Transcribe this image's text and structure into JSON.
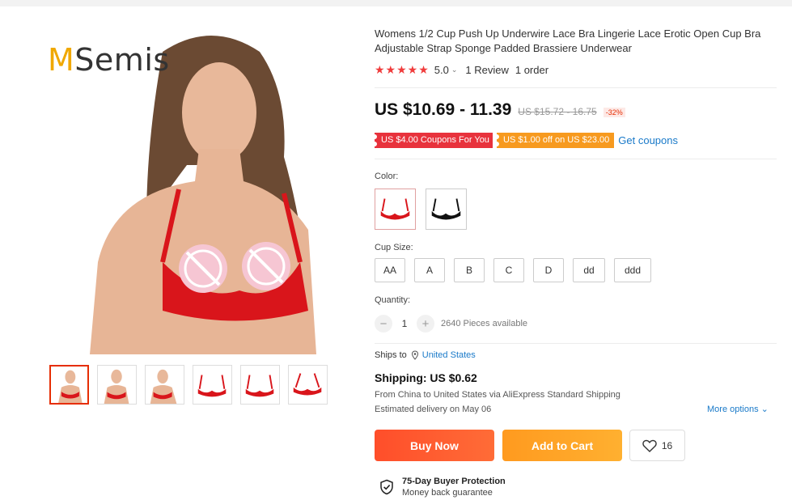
{
  "brand": {
    "initial": "M",
    "rest": "Semis"
  },
  "product": {
    "title": "Womens 1/2 Cup Push Up Underwire Lace Bra Lingerie Lace Erotic Open Cup Bra Adjustable Strap Sponge Padded Brassiere Underwear",
    "stars": "★★★★★",
    "rating": "5.0",
    "rating_chevron": "⌄",
    "reviews": "1 Review",
    "orders": "1 order"
  },
  "price": {
    "current": "US $10.69 - 11.39",
    "original": "US $15.72 - 16.75",
    "discount": "-32%"
  },
  "coupons": {
    "coupon1": "US $4.00 Coupons For You",
    "coupon2": "US $1.00 off on US $23.00",
    "get_coupons": "Get coupons"
  },
  "color": {
    "label": "Color:",
    "options": [
      "red",
      "black"
    ]
  },
  "cup_size": {
    "label": "Cup Size:",
    "options": [
      "AA",
      "A",
      "B",
      "C",
      "D",
      "dd",
      "ddd"
    ]
  },
  "quantity": {
    "label": "Quantity:",
    "minus": "−",
    "value": "1",
    "plus": "+",
    "available": "2640 Pieces available"
  },
  "shipping": {
    "ships_to_label": "Ships to",
    "country": "United States",
    "title": "Shipping: US $0.62",
    "from": "From China to United States via AliExpress Standard Shipping",
    "estimate": "Estimated delivery on May 06",
    "more_options": "More options ⌄"
  },
  "actions": {
    "buy_now": "Buy Now",
    "add_to_cart": "Add to Cart",
    "wishlist_count": "16"
  },
  "protection": {
    "title": "75-Day Buyer Protection",
    "subtitle": "Money back guarantee"
  },
  "colors": {
    "accent_red": "#e62e04",
    "buy_now": "#ff4e2a",
    "add_to_cart": "#ff9a1f",
    "link": "#1a7ac9",
    "stars": "#f03c3c"
  }
}
